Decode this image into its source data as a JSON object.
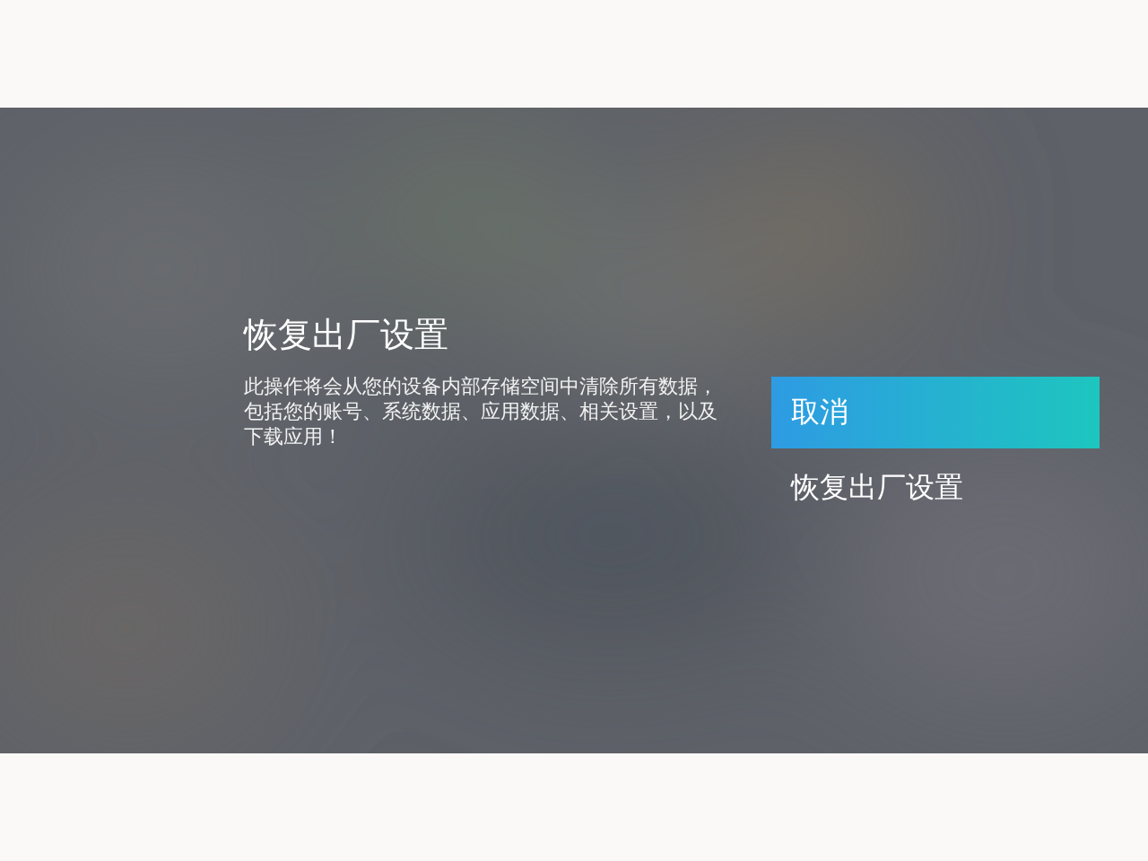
{
  "dialog": {
    "title": "恢复出厂设置",
    "message": "此操作将会从您的设备内部存储空间中清除所有数据，包括您的账号、系统数据、应用数据、相关设置，以及下载应用！"
  },
  "options": [
    {
      "label": "取消",
      "selected": true
    },
    {
      "label": "恢复出厂设置",
      "selected": false
    }
  ]
}
